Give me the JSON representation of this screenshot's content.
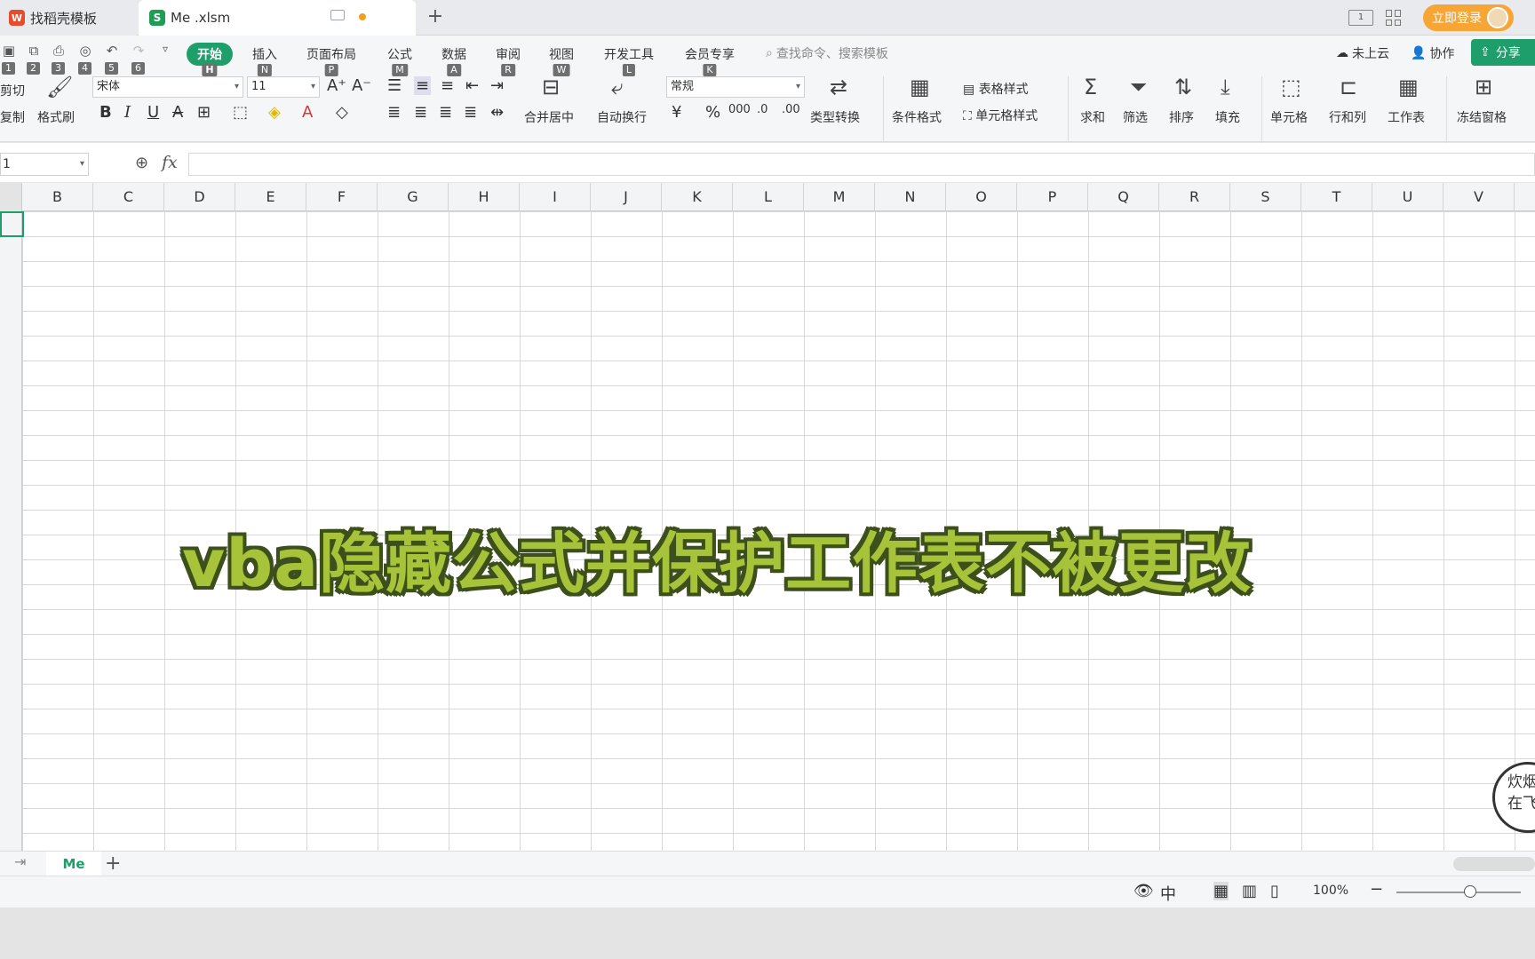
{
  "tabs": {
    "tab1": "找稻壳模板",
    "tab2": "Me .xlsm"
  },
  "titlebar": {
    "login": "立即登录",
    "split_icon_text": "1"
  },
  "menu": {
    "start": "开始",
    "insert": "插入",
    "layout": "页面布局",
    "formula": "公式",
    "data": "数据",
    "review": "审阅",
    "view": "视图",
    "dev": "开发工具",
    "vip": "会员专享",
    "search_placeholder": "查找命令、搜索模板",
    "cloud": "未上云",
    "collab": "协作",
    "share": "分享"
  },
  "hotkeys": {
    "q1": "1",
    "q2": "2",
    "q3": "3",
    "q4": "4",
    "q5": "5",
    "q6": "6",
    "start": "H",
    "insert": "N",
    "layout": "P",
    "formula": "M",
    "data": "A",
    "review": "R",
    "view": "W",
    "dev": "L",
    "vip": "K"
  },
  "ribbon": {
    "cut": "剪切",
    "copy": "复制",
    "format_painter": "格式刷",
    "font": "宋体",
    "font_size": "11",
    "merge": "合并居中",
    "wrap": "自动换行",
    "number_format": "常规",
    "type_convert": "类型转换",
    "cond_format": "条件格式",
    "table_style": "表格样式",
    "cell_style": "单元格样式",
    "sum": "求和",
    "filter": "筛选",
    "sort": "排序",
    "fill": "填充",
    "cell": "单元格",
    "rowcol": "行和列",
    "worksheet": "工作表",
    "freeze": "冻结窗格"
  },
  "formula_bar": {
    "name_box": "1",
    "fx": "fx"
  },
  "columns": [
    "B",
    "C",
    "D",
    "E",
    "F",
    "G",
    "H",
    "I",
    "J",
    "K",
    "L",
    "M",
    "N",
    "O",
    "P",
    "Q",
    "R",
    "S",
    "T",
    "U",
    "V"
  ],
  "overlay": {
    "headline": "vba隐藏公式并保护工作表不被更改",
    "logo_line1": "炊烟",
    "logo_line2": "在飞"
  },
  "sheet_tabs": {
    "active": "Me"
  },
  "status": {
    "zoom": "100%"
  },
  "colors": {
    "accent": "#1e9e6a",
    "login": "#f7a535",
    "headline_fill": "#a6c33a",
    "headline_outline": "#3d4f1a"
  }
}
